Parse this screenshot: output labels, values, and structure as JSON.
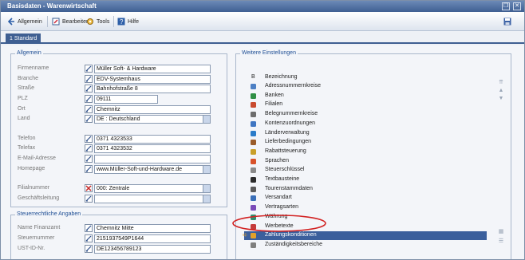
{
  "window": {
    "title": "Basisdaten - Warenwirtschaft",
    "restore_glyph": "❐",
    "close_glyph": "✕"
  },
  "toolbar": {
    "allgemein": "Allgemein",
    "bearbeiten": "Bearbeiten",
    "tools": "Tools",
    "hilfe": "Hilfe"
  },
  "tabs": {
    "active": "1 Standard"
  },
  "allgemein": {
    "legend": "Allgemein",
    "fields": [
      {
        "label": "Firmenname",
        "value": "Müller Soft- & Hardware"
      },
      {
        "label": "Branche",
        "value": "EDV-Systemhaus"
      },
      {
        "label": "Straße",
        "value": "Bahnhofstraße 8"
      },
      {
        "label": "PLZ",
        "value": "09111"
      },
      {
        "label": "Ort",
        "value": "Chemnitz"
      },
      {
        "label": "Land",
        "value": "DE   : Deutschland"
      },
      {
        "label": "Telefon",
        "value": "0371 4323533"
      },
      {
        "label": "Telefax",
        "value": "0371 4323532"
      },
      {
        "label": "E-Mail-Adresse",
        "value": ""
      },
      {
        "label": "Homepage",
        "value": "www.Müller-Soft-und-Hardware.de"
      },
      {
        "label": "Filialnummer",
        "value": " 000: Zentrale"
      },
      {
        "label": "Geschäftsleitung",
        "value": ""
      }
    ]
  },
  "steuer": {
    "legend": "Steuerrechtliche Angaben",
    "fields": [
      {
        "label": "Name Finanzamt",
        "value": "Chemnitz Mitte"
      },
      {
        "label": "Steuernummer",
        "value": "2151937549P1644"
      },
      {
        "label": "UST-ID-Nr.",
        "value": "DE123456789123"
      }
    ]
  },
  "weitere": {
    "legend": "Weitere Einstellungen",
    "col_b": "B",
    "col_bez": "Bezeichnung",
    "items": [
      {
        "label": "Adressnummernkreise",
        "icon": "address-icon"
      },
      {
        "label": "Banken",
        "icon": "bank-icon"
      },
      {
        "label": "Filialen",
        "icon": "branch-icon"
      },
      {
        "label": "Belegnummernkreise",
        "icon": "document-icon"
      },
      {
        "label": "Kontenzuordnungen",
        "icon": "account-icon"
      },
      {
        "label": "Länderverwaltung",
        "icon": "globe-icon"
      },
      {
        "label": "Lieferbedingungen",
        "icon": "delivery-icon"
      },
      {
        "label": "Rabattsteuerung",
        "icon": "discount-icon"
      },
      {
        "label": "Sprachen",
        "icon": "language-icon"
      },
      {
        "label": "Steuerschlüssel",
        "icon": "tax-key-icon"
      },
      {
        "label": "Textbausteine",
        "icon": "text-block-icon"
      },
      {
        "label": "Tourenstammdaten",
        "icon": "tour-icon"
      },
      {
        "label": "Versandart",
        "icon": "shipping-icon"
      },
      {
        "label": "Vertragsarten",
        "icon": "contract-icon"
      },
      {
        "label": "Währung",
        "icon": "currency-icon"
      },
      {
        "label": "Werbetexte",
        "icon": "advertising-icon"
      },
      {
        "label": "Zahlungskonditionen",
        "icon": "payment-icon"
      },
      {
        "label": "Zuständigkeitsbereiche",
        "icon": "responsibility-icon"
      }
    ]
  },
  "colors": {
    "accent": "#3f5f92",
    "selected_row": "#3b5f9c",
    "highlight_circle": "#d22222"
  }
}
